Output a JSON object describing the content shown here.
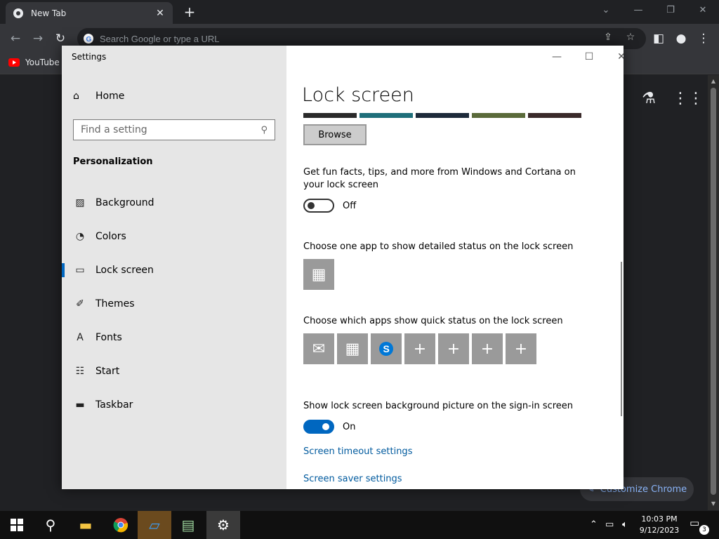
{
  "chrome": {
    "tab_title": "New Tab",
    "omnibox_placeholder": "Search Google or type a URL",
    "bookmark_youtube": "YouTube",
    "customize_label": "Customize Chrome"
  },
  "settings": {
    "window_title": "Settings",
    "home_label": "Home",
    "search_placeholder": "Find a setting",
    "section_label": "Personalization",
    "nav": [
      {
        "label": "Background",
        "icon": "image-icon"
      },
      {
        "label": "Colors",
        "icon": "palette-icon"
      },
      {
        "label": "Lock screen",
        "icon": "lock-screen-icon",
        "active": true
      },
      {
        "label": "Themes",
        "icon": "themes-icon"
      },
      {
        "label": "Fonts",
        "icon": "fonts-icon"
      },
      {
        "label": "Start",
        "icon": "start-icon"
      },
      {
        "label": "Taskbar",
        "icon": "taskbar-icon"
      }
    ],
    "main": {
      "title": "Lock screen",
      "browse_label": "Browse",
      "fun_facts_text": "Get fun facts, tips, and more from Windows and Cortana on your lock screen",
      "fun_facts_toggle": "Off",
      "detailed_status_text": "Choose one app to show detailed status on the lock screen",
      "quick_status_text": "Choose which apps show quick status on the lock screen",
      "signin_bg_text": "Show lock screen background picture on the sign-in screen",
      "signin_bg_toggle": "On",
      "link_timeout": "Screen timeout settings",
      "link_screensaver": "Screen saver settings"
    }
  },
  "taskbar": {
    "time": "10:03 PM",
    "date": "9/12/2023",
    "notification_count": "3"
  },
  "colors": {
    "accent": "#0067c0",
    "link": "#005a9e",
    "tile": "#9a9a9a"
  }
}
